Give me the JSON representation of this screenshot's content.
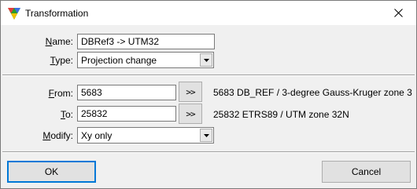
{
  "window": {
    "title": "Transformation"
  },
  "form": {
    "name": {
      "label_accel": "N",
      "label_rest": "ame:",
      "value": "DBRef3 -> UTM32"
    },
    "type": {
      "label_accel": "T",
      "label_rest": "ype:",
      "value": "Projection change"
    },
    "from": {
      "label_accel": "F",
      "label_rest": "rom:",
      "value": "5683",
      "browse": ">>",
      "description": "5683 DB_REF / 3-degree Gauss-Kruger zone 3"
    },
    "to": {
      "label_accel": "T",
      "label_rest": "o:",
      "value": "25832",
      "browse": ">>",
      "description": "25832 ETRS89 / UTM zone 32N"
    },
    "modify": {
      "label_accel": "M",
      "label_rest": "odify:",
      "value": "Xy only"
    }
  },
  "buttons": {
    "ok": "OK",
    "cancel": "Cancel"
  },
  "icons": {
    "app": "app-triangle-icon",
    "close": "close-icon",
    "dropdown": "chevron-down-icon"
  }
}
